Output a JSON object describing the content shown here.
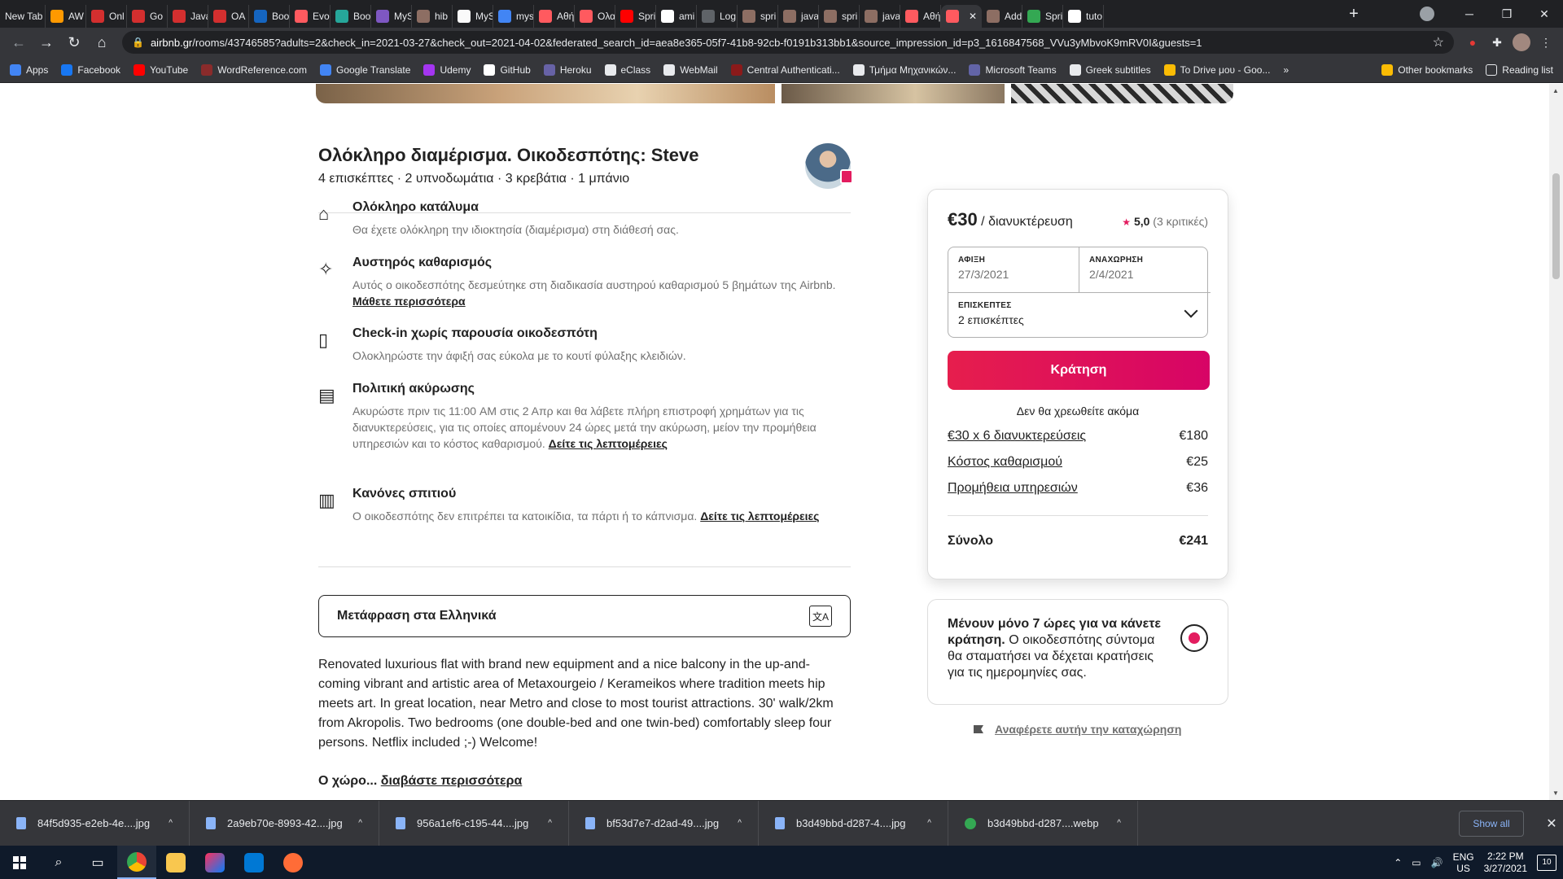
{
  "browser": {
    "tabs": [
      {
        "label": "New Tab",
        "color": "#202124"
      },
      {
        "label": "AW",
        "color": "#ff9900"
      },
      {
        "label": "Onl",
        "color": "#d32f2f"
      },
      {
        "label": "Go",
        "color": "#d32f2f"
      },
      {
        "label": "Java",
        "color": "#d32f2f"
      },
      {
        "label": "OA",
        "color": "#d32f2f"
      },
      {
        "label": "Boo",
        "color": "#1565c0"
      },
      {
        "label": "Evo",
        "color": "#ff5a5f"
      },
      {
        "label": "Boo",
        "color": "#26a69a"
      },
      {
        "label": "MyS",
        "color": "#7e57c2"
      },
      {
        "label": "hib",
        "color": "#8d6e63"
      },
      {
        "label": "MyS",
        "color": "#fafafa"
      },
      {
        "label": "mys",
        "color": "#4285f4"
      },
      {
        "label": "Αθή",
        "color": "#ff5a5f"
      },
      {
        "label": "Ολα",
        "color": "#ff5a5f"
      },
      {
        "label": "Spri",
        "color": "#ff0000"
      },
      {
        "label": "ami",
        "color": "#ffffff"
      },
      {
        "label": "Log",
        "color": "#5f6368"
      },
      {
        "label": "spri",
        "color": "#8d6e63"
      },
      {
        "label": "java",
        "color": "#8d6e63"
      },
      {
        "label": "spri",
        "color": "#8d6e63"
      },
      {
        "label": "java",
        "color": "#8d6e63"
      },
      {
        "label": "Αθή",
        "color": "#ff5a5f"
      },
      {
        "label": "",
        "color": "#ff5a5f",
        "active": true
      },
      {
        "label": "Add",
        "color": "#8d6e63"
      },
      {
        "label": "Spri",
        "color": "#34a853"
      },
      {
        "label": "tuto",
        "color": "#ffffff"
      }
    ],
    "url_domain": "airbnb.gr",
    "url_path": "/rooms/43746585?adults=2&check_in=2021-03-27&check_out=2021-04-02&federated_search_id=aea8e365-05f7-41b8-92cb-f0191b313bb1&source_impression_id=p3_1616847568_VVu3yMbvoK9mRV0I&guests=1",
    "bookmarks": [
      {
        "label": "Apps",
        "color": "#4285f4"
      },
      {
        "label": "Facebook",
        "color": "#1877f2"
      },
      {
        "label": "YouTube",
        "color": "#ff0000"
      },
      {
        "label": "WordReference.com",
        "color": "#8a2b2b"
      },
      {
        "label": "Google Translate",
        "color": "#4285f4"
      },
      {
        "label": "Udemy",
        "color": "#a435f0"
      },
      {
        "label": "GitHub",
        "color": "#ffffff"
      },
      {
        "label": "Heroku",
        "color": "#6762a6"
      },
      {
        "label": "eClass",
        "color": "#e8eaed"
      },
      {
        "label": "WebMail",
        "color": "#e8eaed"
      },
      {
        "label": "Central Authenticati...",
        "color": "#8b1a1a"
      },
      {
        "label": "Τμήμα Μηχανικών...",
        "color": "#e8eaed"
      },
      {
        "label": "Microsoft Teams",
        "color": "#6264a7"
      },
      {
        "label": "Greek subtitles",
        "color": "#e8eaed"
      },
      {
        "label": "To Drive μου - Goo...",
        "color": "#fbbc04"
      }
    ],
    "other_bookmarks": "Other bookmarks",
    "reading_list": "Reading list"
  },
  "listing": {
    "title": "Ολόκληρο διαμέρισμα. Οικοδεσπότης: Steve",
    "subtitle": "4 επισκέπτες · 2 υπνοδωμάτια · 3 κρεβάτια · 1 μπάνιο",
    "features": [
      {
        "icon": "home-icon",
        "title": "Ολόκληρο κατάλυμα",
        "desc": "Θα έχετε ολόκληρη την ιδιοκτησία (διαμέρισμα) στη διάθεσή σας.",
        "link": ""
      },
      {
        "icon": "sparkle-icon",
        "title": "Αυστηρός καθαρισμός",
        "desc": "Αυτός ο οικοδεσπότης δεσμεύτηκε στη διαδικασία αυστηρού καθαρισμού 5 βημάτων της Airbnb.",
        "link": "Μάθετε περισσότερα"
      },
      {
        "icon": "door-icon",
        "title": "Check-in χωρίς παρουσία οικοδεσπότη",
        "desc": "Ολοκληρώστε την άφιξή σας εύκολα με το κουτί φύλαξης κλειδιών.",
        "link": ""
      },
      {
        "icon": "calendar-icon",
        "title": "Πολιτική ακύρωσης",
        "desc": "Ακυρώστε πριν τις 11:00 AM στις 2 Απρ και θα λάβετε πλήρη επιστροφή χρημάτων για τις διανυκτερεύσεις, για τις οποίες απομένουν 24 ώρες μετά την ακύρωση, μείον την προμήθεια υπηρεσιών και το κόστος καθαρισμού.",
        "link": "Δείτε τις λεπτομέρειες"
      },
      {
        "icon": "rulebook-icon",
        "title": "Κανόνες σπιτιού",
        "desc": "Ο οικοδεσπότης δεν επιτρέπει τα κατοικίδια, τα πάρτι ή το κάπνισμα.",
        "link": "Δείτε τις λεπτομέρειες"
      }
    ],
    "translate_label": "Μετάφραση στα Ελληνικά",
    "description": "Renovated luxurious flat with brand new equipment and a nice balcony in the up-and-coming vibrant and artistic area of Metaxourgeio / Kerameikos where tradition meets hip meets art. In great location, near Metro and close to most tourist attractions. 30' walk/2km from Akropolis. Two bedrooms (one double-bed and one twin-bed) comfortably sleep four persons. Netflix included ;-) Welcome!",
    "readmore_lead": "Ο χώρο...",
    "readmore_link": "διαβάστε περισσότερα"
  },
  "booking": {
    "price": "€30",
    "price_unit": "/ διανυκτέρευση",
    "rating": "5,0",
    "reviews": "(3 κριτικές)",
    "checkin_label": "ΑΦΙΞΗ",
    "checkin_value": "27/3/2021",
    "checkout_label": "ΑΝΑΧΩΡΗΣΗ",
    "checkout_value": "2/4/2021",
    "guests_label": "ΕΠΙΣΚΕΠΤΕΣ",
    "guests_value": "2 επισκέπτες",
    "reserve_label": "Κράτηση",
    "no_charge": "Δεν θα χρεωθείτε ακόμα",
    "fees": [
      {
        "label": "€30 x 6 διανυκτερεύσεις",
        "amount": "€180"
      },
      {
        "label": "Κόστος καθαρισμού",
        "amount": "€25"
      },
      {
        "label": "Προμήθεια υπηρεσιών",
        "amount": "€36"
      }
    ],
    "total_label": "Σύνολο",
    "total_amount": "€241",
    "urgency_bold": "Μένουν μόνο 7 ώρες για να κάνετε κράτηση.",
    "urgency_text": "Ο οικοδεσπότης σύντομα θα σταματήσει να δέχεται κρατήσεις για τις ημερομηνίες σας.",
    "report_label": "Αναφέρετε αυτήν την καταχώρηση"
  },
  "downloads": {
    "items": [
      "84f5d935-e2eb-4e....jpg",
      "2a9eb70e-8993-42....jpg",
      "956a1ef6-c195-44....jpg",
      "bf53d7e7-d2ad-49....jpg",
      "b3d49bbd-d287-4....jpg",
      "b3d49bbd-d287....webp"
    ],
    "show_all": "Show all"
  },
  "taskbar": {
    "lang_top": "ENG",
    "lang_bottom": "US",
    "time": "2:22 PM",
    "date": "3/27/2021",
    "notif_count": "10"
  }
}
